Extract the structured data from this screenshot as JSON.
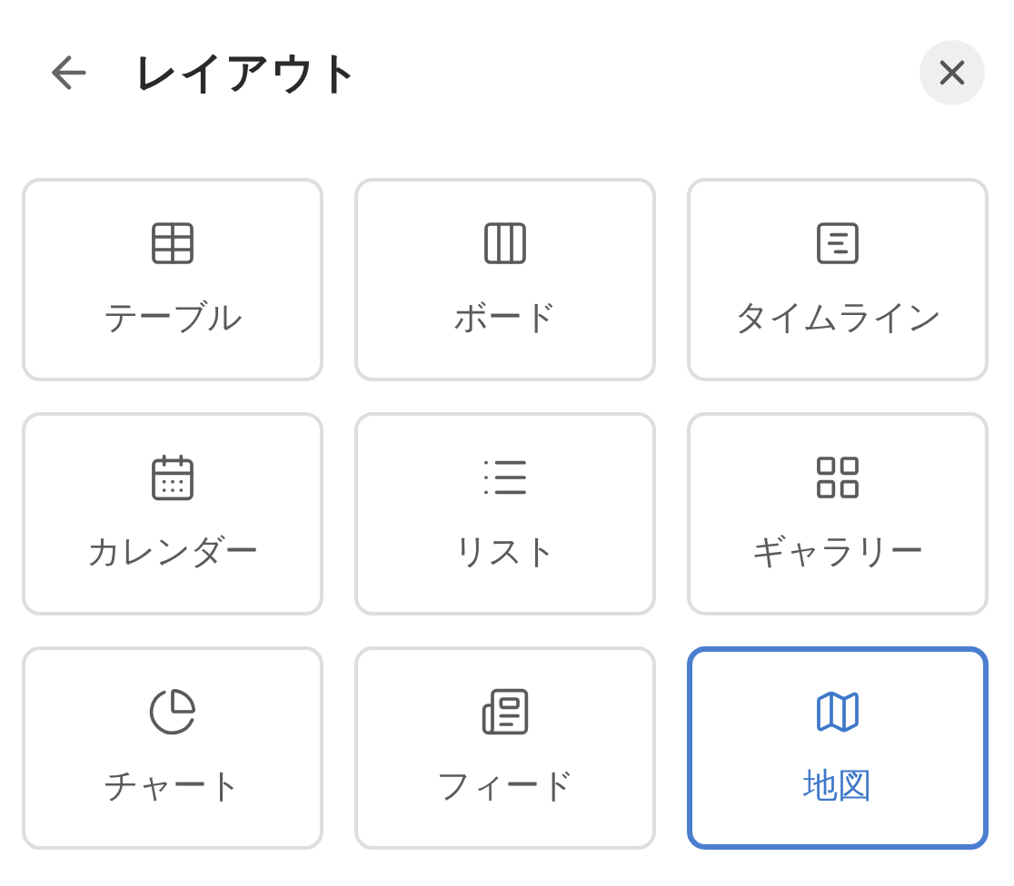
{
  "header": {
    "title": "レイアウト"
  },
  "layouts": [
    {
      "label": "テーブル",
      "kind": "table",
      "selected": false
    },
    {
      "label": "ボード",
      "kind": "board",
      "selected": false
    },
    {
      "label": "タイムライン",
      "kind": "timeline",
      "selected": false
    },
    {
      "label": "カレンダー",
      "kind": "calendar",
      "selected": false
    },
    {
      "label": "リスト",
      "kind": "list",
      "selected": false
    },
    {
      "label": "ギャラリー",
      "kind": "gallery",
      "selected": false
    },
    {
      "label": "チャート",
      "kind": "chart",
      "selected": false
    },
    {
      "label": "フィード",
      "kind": "feed",
      "selected": false
    },
    {
      "label": "地図",
      "kind": "map",
      "selected": true
    }
  ]
}
